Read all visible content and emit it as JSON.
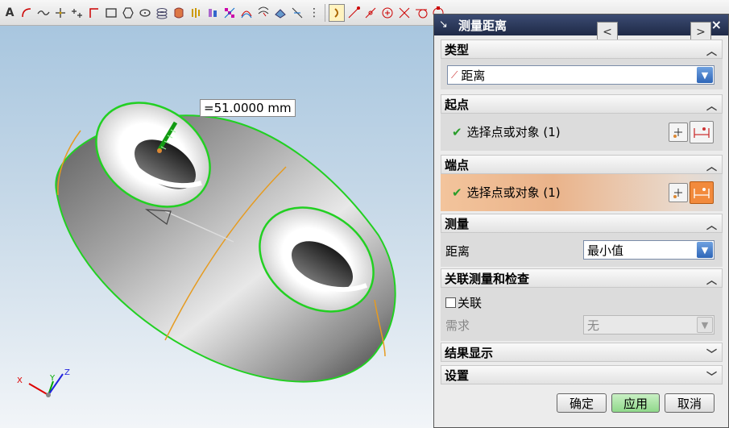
{
  "toolbar": {
    "items": [
      "text-tool",
      "arc-tool",
      "spline-tool",
      "point-tool",
      "point-set-tool",
      "line-tool",
      "rectangle-tool",
      "polygon-tool",
      "ellipse-tool",
      "helix-tool",
      "extrude-tool",
      "revolve-tool",
      "sweep-tool",
      "mesh-tool",
      "curve-tool",
      "offset-tool",
      "surface-tool",
      "measure-tool",
      "snap-tool"
    ]
  },
  "viewport": {
    "measure_label": "=51.0000 mm",
    "axis": {
      "x": "X",
      "y": "Y",
      "z": "Z"
    }
  },
  "dialog": {
    "title": "测量距离",
    "nav_prev": "<",
    "nav_next": ">",
    "close": "×",
    "sections": {
      "type": {
        "label": "类型",
        "value": "距离"
      },
      "start": {
        "label": "起点",
        "selection": "选择点或对象 (1)"
      },
      "end": {
        "label": "端点",
        "selection": "选择点或对象 (1)"
      },
      "measure": {
        "label": "测量",
        "field_label": "距离",
        "value": "最小值"
      },
      "assoc": {
        "label": "关联测量和检查",
        "checkbox_label": "关联",
        "req_label": "需求",
        "req_value": "无"
      },
      "result": {
        "label": "结果显示"
      },
      "settings": {
        "label": "设置"
      }
    },
    "buttons": {
      "ok": "确定",
      "apply": "应用",
      "cancel": "取消"
    }
  },
  "colors": {
    "title_bg": "#1f2a47",
    "highlight_row": "#f0b383",
    "apply_green": "#8fd88a",
    "edge_green": "#22d022",
    "seam_orange": "#e69b1f"
  }
}
